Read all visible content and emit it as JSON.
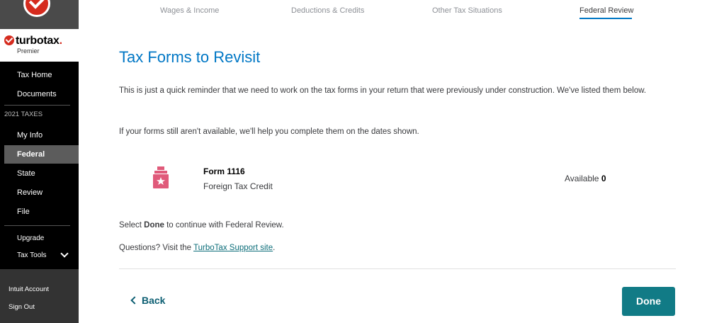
{
  "sidebar": {
    "brand": "turbotax",
    "edition": "Premier",
    "items": [
      {
        "label": "Tax Home"
      },
      {
        "label": "Documents"
      },
      {
        "label": "My Info"
      },
      {
        "label": "Federal"
      },
      {
        "label": "State"
      },
      {
        "label": "Review"
      },
      {
        "label": "File"
      },
      {
        "label": "Upgrade"
      },
      {
        "label": "Tax Tools"
      }
    ],
    "section": "2021 TAXES",
    "bottom": [
      "Intuit Account",
      "Sign Out"
    ]
  },
  "tabs": [
    "Wages & Income",
    "Deductions & Credits",
    "Other Tax Situations",
    "Federal Review"
  ],
  "main": {
    "title": "Tax Forms to Revisit",
    "intro": "This is just a quick reminder that we need to work on the tax forms in your return that were previously under construction. We've listed them below.",
    "help_text": "If your forms still aren't available, we'll help you complete them on the dates shown.",
    "form": {
      "name": "Form 1116",
      "description": "Foreign Tax Credit",
      "available_label": "Available",
      "available_value": "0"
    },
    "select_prefix": "Select ",
    "select_bold": "Done",
    "select_suffix": " to continue with Federal Review.",
    "questions_prefix": "Questions? Visit the ",
    "support_link": "TurboTax Support site",
    "questions_suffix": "."
  },
  "footer": {
    "back": "Back",
    "done": "Done"
  },
  "colors": {
    "accent": "#0077c5",
    "done_button": "#117b86",
    "brand_red": "#d52b1e",
    "form_icon": "#e05a7a"
  }
}
